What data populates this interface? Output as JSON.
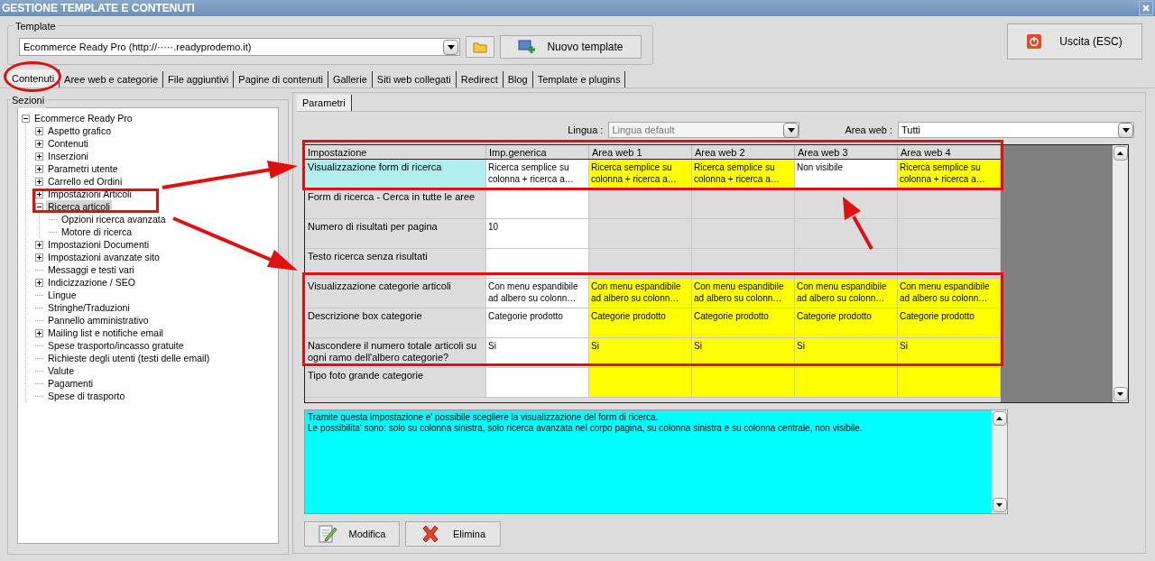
{
  "window": {
    "title": "GESTIONE TEMPLATE E CONTENUTI"
  },
  "template": {
    "label": "Template",
    "value": "Ecommerce Ready Pro (http://·····.readyprodemo.it)",
    "new_button": "Nuovo template"
  },
  "exit_button": "Uscita (ESC)",
  "tabs": [
    {
      "label": "Contenuti",
      "selected": true
    },
    {
      "label": "Aree web e categorie",
      "selected": false
    },
    {
      "label": "File aggiuntivi",
      "selected": false
    },
    {
      "label": "Pagine di contenuti",
      "selected": false
    },
    {
      "label": "Gallerie",
      "selected": false
    },
    {
      "label": "Siti web collegati",
      "selected": false
    },
    {
      "label": "Redirect",
      "selected": false
    },
    {
      "label": "Blog",
      "selected": false
    },
    {
      "label": "Template e plugins",
      "selected": false
    }
  ],
  "sections": {
    "label": "Sezioni",
    "tree": [
      {
        "label": "Ecommerce Ready Pro",
        "kind": "folder",
        "expanded": true,
        "selected": false,
        "children": [
          {
            "label": "Aspetto grafico",
            "kind": "folder",
            "expanded": false,
            "selected": false
          },
          {
            "label": "Contenuti",
            "kind": "folder",
            "expanded": false,
            "selected": false
          },
          {
            "label": "Inserzioni",
            "kind": "folder",
            "expanded": false,
            "selected": false
          },
          {
            "label": "Parametri utente",
            "kind": "folder",
            "expanded": false,
            "selected": false
          },
          {
            "label": "Carrello ed Ordini",
            "kind": "folder",
            "expanded": false,
            "selected": false
          },
          {
            "label": "Impostazioni Articoli",
            "kind": "folder",
            "expanded": false,
            "selected": false
          },
          {
            "label": "Ricerca articoli",
            "kind": "folder",
            "expanded": true,
            "selected": true,
            "children": [
              {
                "label": "Opzioni ricerca avanzata",
                "kind": "leaf",
                "selected": false
              },
              {
                "label": "Motore di ricerca",
                "kind": "leaf",
                "selected": false
              }
            ]
          },
          {
            "label": "Impostazioni Documenti",
            "kind": "folder",
            "expanded": false,
            "selected": false
          },
          {
            "label": "Impostazioni avanzate sito",
            "kind": "folder",
            "expanded": false,
            "selected": false
          },
          {
            "label": "Messaggi e testi vari",
            "kind": "leaf",
            "selected": false
          },
          {
            "label": "Indicizzazione / SEO",
            "kind": "folder",
            "expanded": false,
            "selected": false
          },
          {
            "label": "Lingue",
            "kind": "leaf",
            "selected": false
          },
          {
            "label": "Stringhe/Traduzioni",
            "kind": "leaf",
            "selected": false
          },
          {
            "label": "Pannello amministrativo",
            "kind": "leaf",
            "selected": false
          },
          {
            "label": "Mailing list e notifiche email",
            "kind": "folder",
            "expanded": false,
            "selected": false
          },
          {
            "label": "Spese trasporto/incasso gratuite",
            "kind": "leaf",
            "selected": false
          },
          {
            "label": "Richieste degli utenti (testi delle email)",
            "kind": "leaf",
            "selected": false
          },
          {
            "label": "Valute",
            "kind": "leaf",
            "selected": false
          },
          {
            "label": "Pagamenti",
            "kind": "leaf",
            "selected": false
          },
          {
            "label": "Spese di trasporto",
            "kind": "leaf",
            "selected": false
          }
        ]
      }
    ]
  },
  "params_tab": {
    "label": "Parametri",
    "selected": true
  },
  "filters": {
    "language_label": "Lingua :",
    "language_value": "Lingua default",
    "area_label": "Area web :",
    "area_value": "Tutti"
  },
  "table": {
    "columns": [
      "Impostazione",
      "Imp.generica",
      "Area web 1",
      "Area web 2",
      "Area web 3",
      "Area web 4"
    ],
    "rows": [
      {
        "selected": true,
        "cells": [
          {
            "kind": "name",
            "text": "Visualizzazione form di ricerca"
          },
          {
            "kind": "value",
            "text": "Ricerca semplice su colonna + ricerca a…"
          },
          {
            "kind": "override",
            "text": "Ricerca semplice su colonna + ricerca a…"
          },
          {
            "kind": "override",
            "text": "Ricerca semplice su colonna + ricerca a…"
          },
          {
            "kind": "value",
            "text": "Non visibile"
          },
          {
            "kind": "override",
            "text": "Ricerca semplice su colonna + ricerca a…"
          }
        ]
      },
      {
        "selected": false,
        "cells": [
          {
            "kind": "name",
            "text": "Form di ricerca - Cerca in tutte le aree"
          },
          {
            "kind": "value"
          },
          {
            "kind": "na"
          },
          {
            "kind": "na"
          },
          {
            "kind": "na"
          },
          {
            "kind": "na"
          }
        ]
      },
      {
        "selected": false,
        "cells": [
          {
            "kind": "name",
            "text": "Numero di risultati per pagina"
          },
          {
            "kind": "value",
            "text": "10"
          },
          {
            "kind": "na"
          },
          {
            "kind": "na"
          },
          {
            "kind": "na"
          },
          {
            "kind": "na"
          }
        ]
      },
      {
        "selected": false,
        "cells": [
          {
            "kind": "name",
            "text": "Testo ricerca senza risultati"
          },
          {
            "kind": "value"
          },
          {
            "kind": "na"
          },
          {
            "kind": "na"
          },
          {
            "kind": "na"
          },
          {
            "kind": "na"
          }
        ]
      },
      {
        "selected": false,
        "cells": [
          {
            "kind": "name",
            "text": "Visualizzazione categorie articoli"
          },
          {
            "kind": "value",
            "text": "Con menu espandibile ad albero su colonn…"
          },
          {
            "kind": "override",
            "text": "Con menu espandibile ad albero su colonn…"
          },
          {
            "kind": "override",
            "text": "Con menu espandibile ad albero su colonn…"
          },
          {
            "kind": "override",
            "text": "Con menu espandibile ad albero su colonn…"
          },
          {
            "kind": "override",
            "text": "Con menu espandibile ad albero su colonn…"
          }
        ]
      },
      {
        "selected": false,
        "cells": [
          {
            "kind": "name",
            "text": "Descrizione box categorie"
          },
          {
            "kind": "value",
            "text": "Categorie prodotto"
          },
          {
            "kind": "override",
            "text": "Categorie prodotto"
          },
          {
            "kind": "override",
            "text": "Categorie prodotto"
          },
          {
            "kind": "override",
            "text": "Categorie prodotto"
          },
          {
            "kind": "override",
            "text": "Categorie prodotto"
          }
        ]
      },
      {
        "selected": false,
        "cells": [
          {
            "kind": "name",
            "text": "Nascondere il numero totale articoli su ogni ramo dell'albero categorie?"
          },
          {
            "kind": "value",
            "text": "Si"
          },
          {
            "kind": "override",
            "text": "Si"
          },
          {
            "kind": "override",
            "text": "Si"
          },
          {
            "kind": "override",
            "text": "Si"
          },
          {
            "kind": "override",
            "text": "Si"
          }
        ]
      },
      {
        "selected": false,
        "cells": [
          {
            "kind": "name",
            "text": "Tipo foto grande categorie"
          },
          {
            "kind": "value"
          },
          {
            "kind": "override"
          },
          {
            "kind": "override"
          },
          {
            "kind": "override"
          },
          {
            "kind": "override"
          }
        ]
      }
    ]
  },
  "description": "Tramite questa impostazione e' possibile scegliere la visualizzazione del form di ricerca.\nLe possibilita' sono: solo su colonna sinistra, solo ricerca avanzata nel corpo pagina, su colonna sinistra e su colonna centrale, non visibile.",
  "buttons": [
    {
      "kind": "edit",
      "label": "Modifica"
    },
    {
      "kind": "delete",
      "label": "Elimina"
    }
  ]
}
